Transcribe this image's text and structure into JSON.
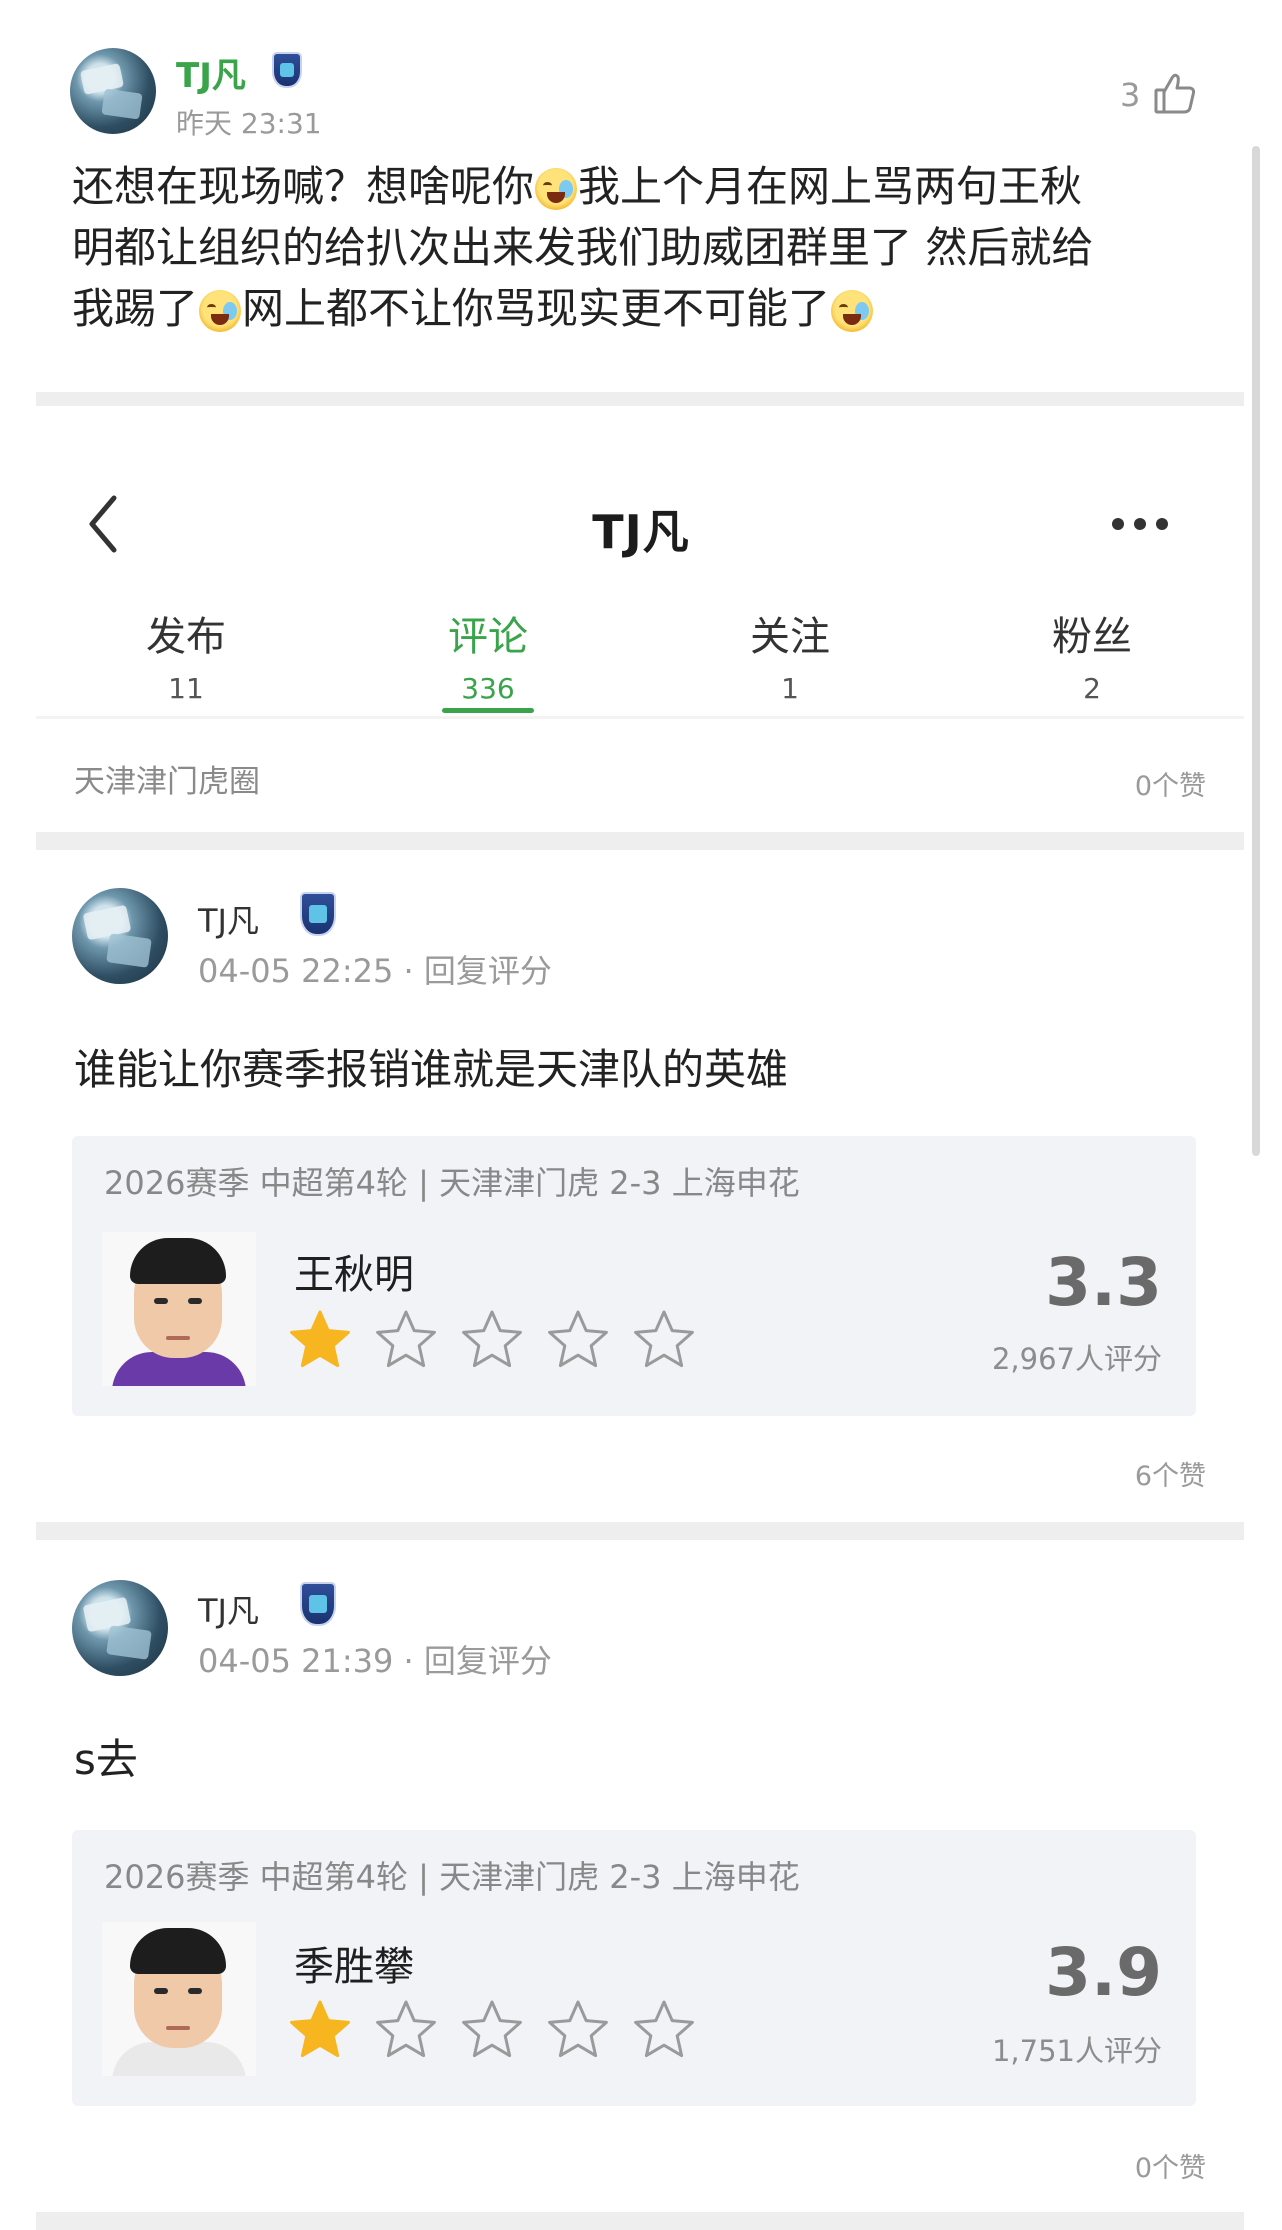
{
  "top_comment": {
    "username": "TJ凡",
    "time": "昨天 23:31",
    "like_count": "3",
    "text_lines": [
      [
        "还想在现场喊？想啥呢你",
        "emoji",
        "我上个月在网上骂两句王秋"
      ],
      [
        "明都让组织的给扒次出来发我们助威团群里了 然后就给"
      ],
      [
        "我踢了",
        "emoji",
        "网上都不让你骂现实更不可能了",
        "emoji"
      ]
    ]
  },
  "header": {
    "back_icon": "chevron-left-icon",
    "title": "TJ凡",
    "more_icon": "more-dots-icon"
  },
  "tabs": [
    {
      "label": "发布",
      "count": "11",
      "active": false
    },
    {
      "label": "评论",
      "count": "336",
      "active": true
    },
    {
      "label": "关注",
      "count": "1",
      "active": false
    },
    {
      "label": "粉丝",
      "count": "2",
      "active": false
    }
  ],
  "group": {
    "name": "天津津门虎圈",
    "likes": "0个赞"
  },
  "comments": [
    {
      "username": "TJ凡",
      "meta": "04-05 22:25 · 回复评分",
      "text": "谁能让你赛季报销谁就是天津队的英雄",
      "card": {
        "match": "2026赛季 中超第4轮 | 天津津门虎 2-3 上海申花",
        "player": "王秋明",
        "rating_stars": 1,
        "max_stars": 5,
        "score": "3.3",
        "raters": "2,967人评分",
        "jersey_color": "#6a3aa8"
      },
      "likes": "6个赞"
    },
    {
      "username": "TJ凡",
      "meta": "04-05 21:39 · 回复评分",
      "text": "s去",
      "card": {
        "match": "2026赛季 中超第4轮 | 天津津门虎 2-3 上海申花",
        "player": "季胜攀",
        "rating_stars": 1,
        "max_stars": 5,
        "score": "3.9",
        "raters": "1,751人评分",
        "jersey_color": "#e9e9e9"
      },
      "likes": "0个赞"
    }
  ],
  "colors": {
    "accent": "#39a44a",
    "star": "#f7b520",
    "card_bg": "#f1f3f6"
  }
}
